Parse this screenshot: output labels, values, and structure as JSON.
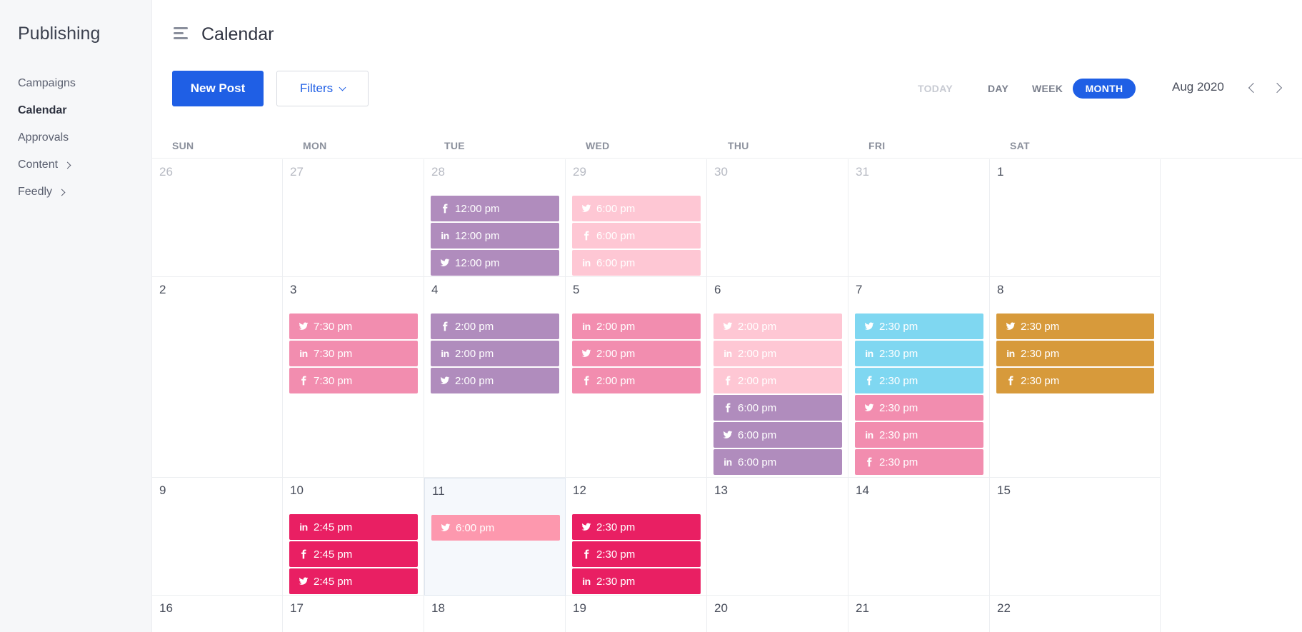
{
  "sidebar": {
    "title": "Publishing",
    "items": [
      {
        "label": "Campaigns",
        "active": false,
        "chevron": false
      },
      {
        "label": "Calendar",
        "active": true,
        "chevron": false
      },
      {
        "label": "Approvals",
        "active": false,
        "chevron": false
      },
      {
        "label": "Content",
        "active": false,
        "chevron": true
      },
      {
        "label": "Feedly",
        "active": false,
        "chevron": true
      }
    ]
  },
  "header": {
    "title": "Calendar",
    "menu_icon": "hamburger-menu-icon"
  },
  "toolbar": {
    "new_post_label": "New Post",
    "filters_label": "Filters",
    "views": {
      "today": "TODAY",
      "day": "DAY",
      "week": "WEEK",
      "month": "MONTH"
    },
    "selected_view": "MONTH",
    "period": "Aug 2020"
  },
  "colors": {
    "accent": "#1f5fe5",
    "purple": "#b08cbd",
    "pale_pink": "#fec7d4",
    "pink": "#f28daf",
    "cyan": "#7fd7f1",
    "orange": "#d79a3b",
    "magenta": "#e91f63",
    "soft_pink": "#fd98ae",
    "deep_purple": "#6a1b7a"
  },
  "calendar": {
    "weekdays": [
      "SUN",
      "MON",
      "TUE",
      "WED",
      "THU",
      "FRI",
      "SAT"
    ],
    "weeks": [
      {
        "days": [
          {
            "day": "26",
            "muted": true,
            "posts": []
          },
          {
            "day": "27",
            "muted": true,
            "posts": []
          },
          {
            "day": "28",
            "muted": true,
            "posts": [
              {
                "network": "facebook",
                "time": "12:00 pm",
                "color": "purple"
              },
              {
                "network": "linkedin",
                "time": "12:00 pm",
                "color": "purple"
              },
              {
                "network": "twitter",
                "time": "12:00 pm",
                "color": "purple"
              }
            ]
          },
          {
            "day": "29",
            "muted": true,
            "posts": [
              {
                "network": "twitter",
                "time": "6:00 pm",
                "color": "pale_pink"
              },
              {
                "network": "facebook",
                "time": "6:00 pm",
                "color": "pale_pink"
              },
              {
                "network": "linkedin",
                "time": "6:00 pm",
                "color": "pale_pink"
              }
            ]
          },
          {
            "day": "30",
            "muted": true,
            "posts": []
          },
          {
            "day": "31",
            "muted": true,
            "posts": []
          },
          {
            "day": "1",
            "muted": false,
            "posts": []
          }
        ]
      },
      {
        "days": [
          {
            "day": "2",
            "muted": false,
            "posts": []
          },
          {
            "day": "3",
            "muted": false,
            "posts": [
              {
                "network": "twitter",
                "time": "7:30 pm",
                "color": "pink"
              },
              {
                "network": "linkedin",
                "time": "7:30 pm",
                "color": "pink"
              },
              {
                "network": "facebook",
                "time": "7:30 pm",
                "color": "pink"
              }
            ]
          },
          {
            "day": "4",
            "muted": false,
            "posts": [
              {
                "network": "facebook",
                "time": "2:00 pm",
                "color": "purple"
              },
              {
                "network": "linkedin",
                "time": "2:00 pm",
                "color": "purple"
              },
              {
                "network": "twitter",
                "time": "2:00 pm",
                "color": "purple"
              }
            ]
          },
          {
            "day": "5",
            "muted": false,
            "posts": [
              {
                "network": "linkedin",
                "time": "2:00 pm",
                "color": "pink"
              },
              {
                "network": "twitter",
                "time": "2:00 pm",
                "color": "pink"
              },
              {
                "network": "facebook",
                "time": "2:00 pm",
                "color": "pink"
              }
            ]
          },
          {
            "day": "6",
            "muted": false,
            "posts": [
              {
                "network": "twitter",
                "time": "2:00 pm",
                "color": "pale_pink"
              },
              {
                "network": "linkedin",
                "time": "2:00 pm",
                "color": "pale_pink"
              },
              {
                "network": "facebook",
                "time": "2:00 pm",
                "color": "pale_pink"
              },
              {
                "network": "facebook",
                "time": "6:00 pm",
                "color": "purple"
              },
              {
                "network": "twitter",
                "time": "6:00 pm",
                "color": "purple"
              },
              {
                "network": "linkedin",
                "time": "6:00 pm",
                "color": "purple"
              }
            ]
          },
          {
            "day": "7",
            "muted": false,
            "posts": [
              {
                "network": "twitter",
                "time": "2:30 pm",
                "color": "cyan"
              },
              {
                "network": "linkedin",
                "time": "2:30 pm",
                "color": "cyan"
              },
              {
                "network": "facebook",
                "time": "2:30 pm",
                "color": "cyan"
              },
              {
                "network": "twitter",
                "time": "2:30 pm",
                "color": "pink"
              },
              {
                "network": "linkedin",
                "time": "2:30 pm",
                "color": "pink"
              },
              {
                "network": "facebook",
                "time": "2:30 pm",
                "color": "pink"
              }
            ]
          },
          {
            "day": "8",
            "muted": false,
            "posts": [
              {
                "network": "twitter",
                "time": "2:30 pm",
                "color": "orange"
              },
              {
                "network": "linkedin",
                "time": "2:30 pm",
                "color": "orange"
              },
              {
                "network": "facebook",
                "time": "2:30 pm",
                "color": "orange"
              }
            ]
          }
        ]
      },
      {
        "days": [
          {
            "day": "9",
            "muted": false,
            "posts": []
          },
          {
            "day": "10",
            "muted": false,
            "posts": [
              {
                "network": "linkedin",
                "time": "2:45 pm",
                "color": "magenta"
              },
              {
                "network": "facebook",
                "time": "2:45 pm",
                "color": "magenta"
              },
              {
                "network": "twitter",
                "time": "2:45 pm",
                "color": "magenta"
              }
            ]
          },
          {
            "day": "11",
            "muted": false,
            "today": true,
            "posts": [
              {
                "network": "twitter",
                "time": "6:00 pm",
                "color": "soft_pink"
              }
            ]
          },
          {
            "day": "12",
            "muted": false,
            "posts": [
              {
                "network": "twitter",
                "time": "2:30 pm",
                "color": "magenta"
              },
              {
                "network": "facebook",
                "time": "2:30 pm",
                "color": "magenta"
              },
              {
                "network": "linkedin",
                "time": "2:30 pm",
                "color": "magenta"
              }
            ]
          },
          {
            "day": "13",
            "muted": false,
            "posts": []
          },
          {
            "day": "14",
            "muted": false,
            "posts": []
          },
          {
            "day": "15",
            "muted": false,
            "posts": []
          }
        ]
      },
      {
        "days": [
          {
            "day": "16",
            "muted": false,
            "posts": []
          },
          {
            "day": "17",
            "muted": false,
            "posts": []
          },
          {
            "day": "18",
            "muted": false,
            "posts": [
              {
                "network": "none",
                "time": "",
                "color": "deep_purple"
              }
            ]
          },
          {
            "day": "19",
            "muted": false,
            "posts": []
          },
          {
            "day": "20",
            "muted": false,
            "posts": []
          },
          {
            "day": "21",
            "muted": false,
            "posts": []
          },
          {
            "day": "22",
            "muted": false,
            "posts": []
          }
        ]
      }
    ]
  }
}
